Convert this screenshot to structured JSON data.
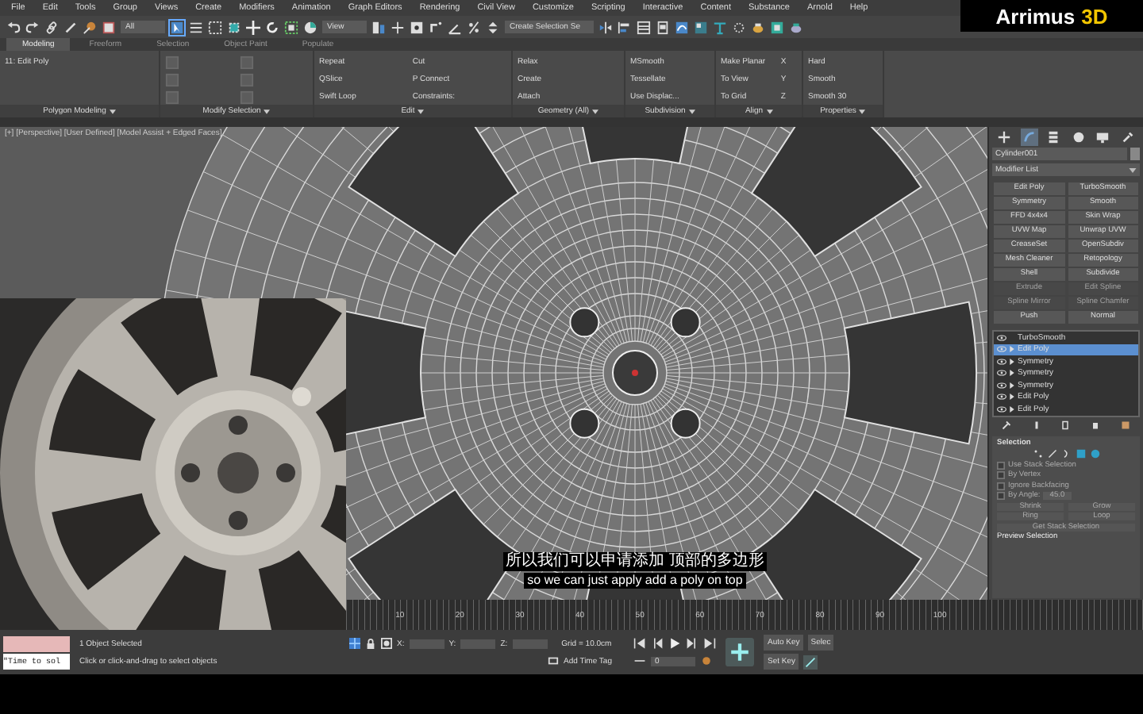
{
  "menu": [
    "File",
    "Edit",
    "Tools",
    "Group",
    "Views",
    "Create",
    "Modifiers",
    "Animation",
    "Graph Editors",
    "Rendering",
    "Civil View",
    "Customize",
    "Scripting",
    "Interactive",
    "Content",
    "Substance",
    "Arnold",
    "Help"
  ],
  "logo": {
    "name": "Arrimus",
    "suffix": "3D"
  },
  "toolbar": {
    "selection_filter": "All",
    "reference": "View",
    "selection_set": "Create Selection Se"
  },
  "ribbon": {
    "tabs": [
      {
        "label": "Modeling",
        "selected": true
      },
      {
        "label": "Freeform",
        "selected": false
      },
      {
        "label": "Selection",
        "selected": false
      },
      {
        "label": "Object Paint",
        "selected": false
      },
      {
        "label": "Populate",
        "selected": false
      }
    ],
    "groups": [
      {
        "title": "Polygon Modeling",
        "items": [
          "11: Edit Poly"
        ]
      },
      {
        "title": "Modify Selection"
      },
      {
        "title": "Edit",
        "items": [
          "Repeat",
          "QSlice",
          "Swift Loop",
          "Cut",
          "P Connect",
          "Constraints:"
        ]
      },
      {
        "title": "Geometry (All)",
        "items": [
          "Relax",
          "Create",
          "Attach"
        ]
      },
      {
        "title": "Subdivision",
        "items": [
          "MSmooth",
          "Tessellate",
          "Use Displac..."
        ]
      },
      {
        "title": "Align",
        "items": [
          "Make Planar",
          "To View",
          "To Grid",
          "X",
          "Y",
          "Z"
        ]
      },
      {
        "title": "Properties",
        "items": [
          "Hard",
          "Smooth",
          "Smooth 30"
        ]
      }
    ]
  },
  "viewport": {
    "label": "[+] [Perspective] [User Defined] [Model Assist + Edged Faces]",
    "subtitles": [
      "所以我们可以申请添加 顶部的多边形",
      "so we can just apply add a poly on top"
    ]
  },
  "command_panel": {
    "tabs": [
      {
        "kind": "create",
        "selected": false
      },
      {
        "kind": "modify",
        "selected": true
      },
      {
        "kind": "hierarchy",
        "selected": false
      },
      {
        "kind": "motion",
        "selected": false
      },
      {
        "kind": "display",
        "selected": false
      },
      {
        "kind": "utilities",
        "selected": false
      }
    ],
    "object_name": "Cylinder001",
    "modifier_list": "Modifier List",
    "modifier_buttons": [
      {
        "label": "Edit Poly",
        "disabled": false
      },
      {
        "label": "TurboSmooth",
        "disabled": false
      },
      {
        "label": "Symmetry",
        "disabled": false
      },
      {
        "label": "Smooth",
        "disabled": false
      },
      {
        "label": "FFD 4x4x4",
        "disabled": false
      },
      {
        "label": "Skin Wrap",
        "disabled": false
      },
      {
        "label": "UVW Map",
        "disabled": false
      },
      {
        "label": "Unwrap UVW",
        "disabled": false
      },
      {
        "label": "CreaseSet",
        "disabled": false
      },
      {
        "label": "OpenSubdiv",
        "disabled": false
      },
      {
        "label": "Mesh Cleaner",
        "disabled": false
      },
      {
        "label": "Retopology",
        "disabled": false
      },
      {
        "label": "Shell",
        "disabled": false
      },
      {
        "label": "Subdivide",
        "disabled": false
      },
      {
        "label": "Extrude",
        "disabled": true
      },
      {
        "label": "Edit Spline",
        "disabled": true
      },
      {
        "label": "Spline Mirror",
        "disabled": true
      },
      {
        "label": "Spline Chamfer",
        "disabled": true
      },
      {
        "label": "Push",
        "disabled": false
      },
      {
        "label": "Normal",
        "disabled": false
      }
    ],
    "stack": [
      {
        "label": "TurboSmooth",
        "selected": false,
        "expandable": false
      },
      {
        "label": "Edit Poly",
        "selected": true,
        "expandable": true
      },
      {
        "label": "Symmetry",
        "selected": false,
        "expandable": true
      },
      {
        "label": "Symmetry",
        "selected": false,
        "expandable": true
      },
      {
        "label": "Symmetry",
        "selected": false,
        "expandable": true
      },
      {
        "label": "Edit Poly",
        "selected": false,
        "expandable": true
      },
      {
        "label": "Edit Poly",
        "selected": false,
        "expandable": true
      }
    ],
    "selection": {
      "title": "Selection",
      "options": [
        {
          "label": "Use Stack Selection",
          "checked": false
        },
        {
          "label": "By Vertex",
          "checked": false
        },
        {
          "label": "Ignore Backfacing",
          "checked": false
        },
        {
          "label": "By Angle:",
          "checked": false
        }
      ],
      "angle": "45.0",
      "buttons": [
        "Shrink",
        "Grow"
      ],
      "spinners": [
        "Ring",
        "Loop"
      ],
      "stack_button": "Get Stack Selection",
      "preview": "Preview Selection"
    }
  },
  "timeline": {
    "ticks": [
      "10",
      "20",
      "30",
      "40",
      "50",
      "60",
      "70",
      "80",
      "90",
      "100"
    ]
  },
  "status": {
    "listener": "\"Time to sol",
    "selection": "1 Object Selected",
    "prompt": "Click or click-and-drag to select objects",
    "coords": [
      "X:",
      "Y:",
      "Z:"
    ],
    "grid": "Grid = 10.0cm",
    "time_tag": "Add Time Tag",
    "frame": "0",
    "auto_key": "Auto Key",
    "set_key": "Set Key",
    "selected": "Selec"
  }
}
